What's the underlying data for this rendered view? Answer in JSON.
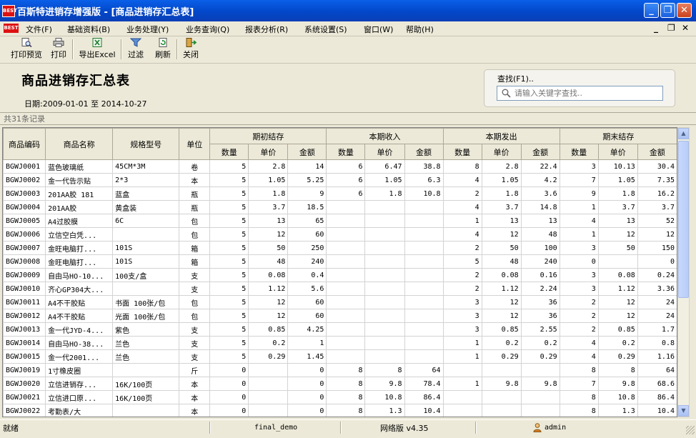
{
  "window": {
    "logo": "BEST",
    "title": "百斯特进销存增强版 - [商品进销存汇总表]",
    "minimize_glyph": "_",
    "restore_glyph": "❐",
    "close_glyph": "✕"
  },
  "menu": {
    "logo": "BEST",
    "items": [
      "文件(F)",
      "基础资料(B)",
      "业务处理(Y)",
      "业务查询(Q)",
      "报表分析(R)",
      "系统设置(S)",
      "窗口(W)",
      "帮助(H)"
    ],
    "mdi_minimize": "_",
    "mdi_restore": "❐",
    "mdi_close": "✕"
  },
  "toolbar": {
    "print_preview": "打印预览",
    "print": "打印",
    "export_excel": "导出Excel",
    "filter": "过滤",
    "refresh": "刷新",
    "close": "关闭"
  },
  "report": {
    "title": "商品进销存汇总表",
    "date_range": "日期:2009-01-01 至 2014-10-27",
    "record_count": "共31条记录"
  },
  "search": {
    "label": "查找(F1)..",
    "placeholder": "请输入关键字查找.."
  },
  "table": {
    "headers": {
      "code": "商品编码",
      "name": "商品名称",
      "spec": "规格型号",
      "unit": "单位",
      "opening": "期初结存",
      "income": "本期收入",
      "issue": "本期发出",
      "closing": "期末结存",
      "qty": "数量",
      "price": "单价",
      "amount": "金额"
    },
    "rows": [
      [
        "BGWJ0001",
        "蓝色玻璃纸",
        "45CM*3M",
        "卷",
        "5",
        "2.8",
        "14",
        "6",
        "6.47",
        "38.8",
        "8",
        "2.8",
        "22.4",
        "3",
        "10.13",
        "30.4"
      ],
      [
        "BGWJ0002",
        "金一代告示贴",
        "2*3",
        "本",
        "5",
        "1.05",
        "5.25",
        "6",
        "1.05",
        "6.3",
        "4",
        "1.05",
        "4.2",
        "7",
        "1.05",
        "7.35"
      ],
      [
        "BGWJ0003",
        "201AA胶 181",
        "蓝盒",
        "瓶",
        "5",
        "1.8",
        "9",
        "6",
        "1.8",
        "10.8",
        "2",
        "1.8",
        "3.6",
        "9",
        "1.8",
        "16.2"
      ],
      [
        "BGWJ0004",
        "201AA胶",
        "黄盒装",
        "瓶",
        "5",
        "3.7",
        "18.5",
        "",
        "",
        "",
        "4",
        "3.7",
        "14.8",
        "1",
        "3.7",
        "3.7"
      ],
      [
        "BGWJ0005",
        "A4过胶膜",
        "6C",
        "包",
        "5",
        "13",
        "65",
        "",
        "",
        "",
        "1",
        "13",
        "13",
        "4",
        "13",
        "52"
      ],
      [
        "BGWJ0006",
        "立信空白凭...",
        "",
        "包",
        "5",
        "12",
        "60",
        "",
        "",
        "",
        "4",
        "12",
        "48",
        "1",
        "12",
        "12"
      ],
      [
        "BGWJ0007",
        "金旺电脑打...",
        "101S",
        "箱",
        "5",
        "50",
        "250",
        "",
        "",
        "",
        "2",
        "50",
        "100",
        "3",
        "50",
        "150"
      ],
      [
        "BGWJ0008",
        "金旺电脑打...",
        "101S",
        "箱",
        "5",
        "48",
        "240",
        "",
        "",
        "",
        "5",
        "48",
        "240",
        "0",
        "",
        "0"
      ],
      [
        "BGWJ0009",
        "自由马HO-10...",
        "100支/盒",
        "支",
        "5",
        "0.08",
        "0.4",
        "",
        "",
        "",
        "2",
        "0.08",
        "0.16",
        "3",
        "0.08",
        "0.24"
      ],
      [
        "BGWJ0010",
        "齐心GP304大...",
        "",
        "支",
        "5",
        "1.12",
        "5.6",
        "",
        "",
        "",
        "2",
        "1.12",
        "2.24",
        "3",
        "1.12",
        "3.36"
      ],
      [
        "BGWJ0011",
        "A4不干胶贴",
        "书面 100张/包",
        "包",
        "5",
        "12",
        "60",
        "",
        "",
        "",
        "3",
        "12",
        "36",
        "2",
        "12",
        "24"
      ],
      [
        "BGWJ0012",
        "A4不干胶贴",
        "光面 100张/包",
        "包",
        "5",
        "12",
        "60",
        "",
        "",
        "",
        "3",
        "12",
        "36",
        "2",
        "12",
        "24"
      ],
      [
        "BGWJ0013",
        "金一代JYD-4...",
        "紫色",
        "支",
        "5",
        "0.85",
        "4.25",
        "",
        "",
        "",
        "3",
        "0.85",
        "2.55",
        "2",
        "0.85",
        "1.7"
      ],
      [
        "BGWJ0014",
        "自由马HO-38...",
        "兰色",
        "支",
        "5",
        "0.2",
        "1",
        "",
        "",
        "",
        "1",
        "0.2",
        "0.2",
        "4",
        "0.2",
        "0.8"
      ],
      [
        "BGWJ0015",
        "金一代2001...",
        "兰色",
        "支",
        "5",
        "0.29",
        "1.45",
        "",
        "",
        "",
        "1",
        "0.29",
        "0.29",
        "4",
        "0.29",
        "1.16"
      ],
      [
        "BGWJ0019",
        "1寸橡皮圈",
        "",
        "斤",
        "0",
        "",
        "0",
        "8",
        "8",
        "64",
        "",
        "",
        "",
        "8",
        "8",
        "64"
      ],
      [
        "BGWJ0020",
        "立信进销存...",
        "16K/100页",
        "本",
        "0",
        "",
        "0",
        "8",
        "9.8",
        "78.4",
        "1",
        "9.8",
        "9.8",
        "7",
        "9.8",
        "68.6"
      ],
      [
        "BGWJ0021",
        "立信进口原...",
        "16K/100页",
        "本",
        "0",
        "",
        "0",
        "8",
        "10.8",
        "86.4",
        "",
        "",
        "",
        "8",
        "10.8",
        "86.4"
      ],
      [
        "BGWJ0022",
        "考勤表/大",
        "",
        "本",
        "0",
        "",
        "0",
        "8",
        "1.3",
        "10.4",
        "",
        "",
        "",
        "8",
        "1.3",
        "10.4"
      ]
    ]
  },
  "status": {
    "ready": "就绪",
    "database": "final_demo",
    "version": "网络版 v4.35",
    "user": "admin"
  }
}
